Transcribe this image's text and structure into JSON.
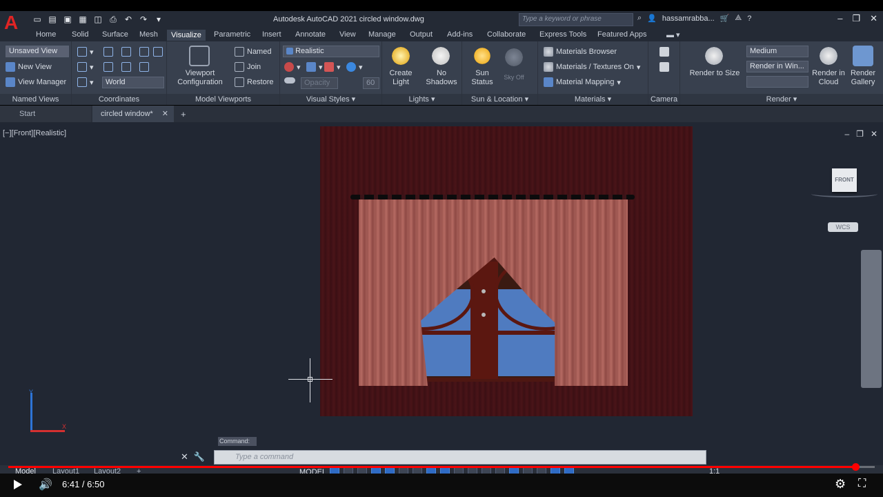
{
  "app": {
    "logo": "A",
    "title": "Autodesk AutoCAD 2021   circled window.dwg",
    "search_placeholder": "Type a keyword or phrase",
    "user": "hassamrabba..."
  },
  "ribbon_tabs": [
    "Home",
    "Solid",
    "Surface",
    "Mesh",
    "Visualize",
    "Parametric",
    "Insert",
    "Annotate",
    "View",
    "Manage",
    "Output",
    "Add-ins",
    "Collaborate",
    "Express Tools",
    "Featured Apps"
  ],
  "active_tab": "Visualize",
  "panels": {
    "named_views": {
      "title": "Named Views",
      "combo": "Unsaved View",
      "new_view": "New View",
      "view_manager": "View Manager"
    },
    "coordinates": {
      "title": "Coordinates",
      "combo": "World"
    },
    "model_viewports": {
      "title": "Model Viewports",
      "viewport_config": "Viewport Configuration",
      "named": "Named",
      "join": "Join",
      "restore": "Restore"
    },
    "visual_styles": {
      "title": "Visual Styles",
      "combo": "Realistic",
      "opacity_label": "Opacity",
      "opacity_value": "60"
    },
    "lights": {
      "title": "Lights",
      "create_light": "Create Light",
      "no_shadows": "No Shadows"
    },
    "sun_location": {
      "title": "Sun & Location",
      "sun_status": "Sun Status",
      "sky_off": "Sky Off"
    },
    "materials": {
      "title": "Materials",
      "browser": "Materials Browser",
      "textures": "Materials / Textures On",
      "mapping": "Material Mapping"
    },
    "camera": {
      "title": "Camera"
    },
    "render": {
      "title": "Render",
      "render_to_size": "Render to Size",
      "quality": "Medium",
      "render_in": "Render in Win...",
      "render_cloud": "Render in Cloud",
      "render_gallery": "Render Gallery"
    }
  },
  "file_tabs": {
    "start": "Start",
    "active": "circled window*"
  },
  "viewport": {
    "label": "[−][Front][Realistic]",
    "viewcube_face": "FRONT",
    "wcs": "WCS",
    "ucs_x": "X",
    "ucs_y": "Y"
  },
  "command": {
    "history": "Command:",
    "placeholder": "Type a command"
  },
  "status": {
    "layout_tabs": [
      "Model",
      "Layout1",
      "Layout2"
    ],
    "model_button": "MODEL",
    "scale": "1:1"
  },
  "player": {
    "time": "6:41 / 6:50",
    "progress": 0.9775
  },
  "colors": {
    "accent_red": "#e02424",
    "progress": "#ff0000",
    "curtain": "#a85e57",
    "wall": "#44121a",
    "glass": "#4f7bc0"
  }
}
